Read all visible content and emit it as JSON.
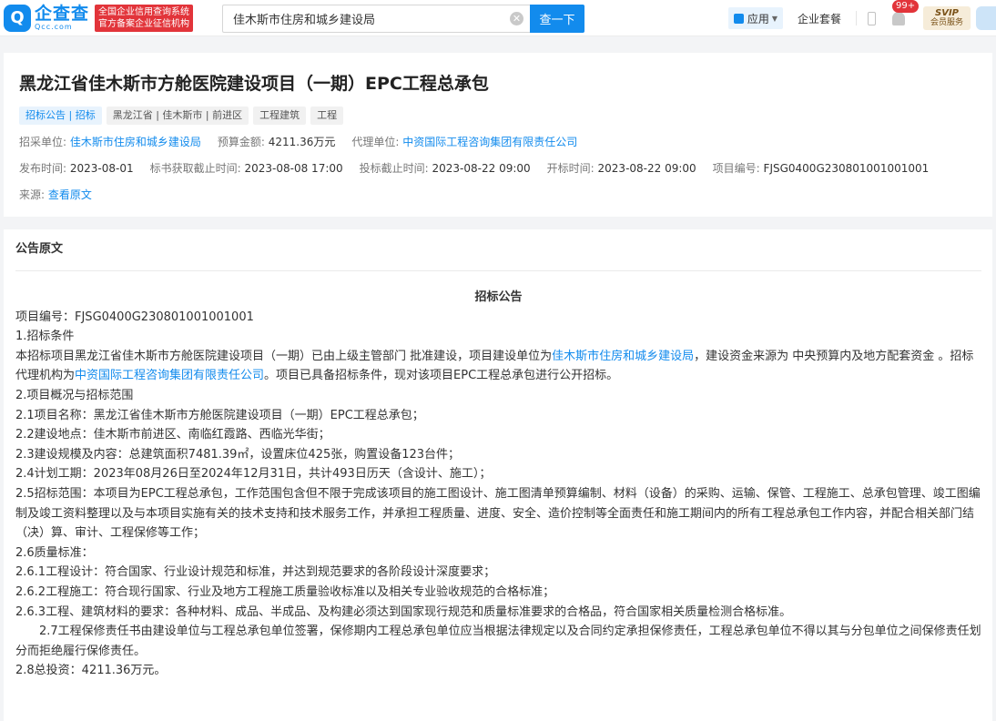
{
  "topbar": {
    "logo_mark": "Q",
    "logo_cn": "企查查",
    "logo_en": "Qcc.com",
    "slogan_line1": "全国企业信用查询系统",
    "slogan_line2": "官方备案企业征信机构",
    "search_value": "佳木斯市住房和城乡建设局",
    "search_button": "查一下",
    "app_label": "应用",
    "enterprise_package": "企业套餐",
    "notification_badge": "99+",
    "svip_top": "SVIP",
    "svip_bottom": "会员服务"
  },
  "header": {
    "title": "黑龙江省佳木斯市方舱医院建设项目（一期）EPC工程总承包",
    "tags": [
      "招标公告 | 招标",
      "黑龙江省 | 佳木斯市 | 前进区",
      "工程建筑",
      "工程"
    ],
    "purchaser_label": "招采单位:",
    "purchaser_value": "佳木斯市住房和城乡建设局",
    "budget_label": "预算金额:",
    "budget_value": "4211.36万元",
    "agent_label": "代理单位:",
    "agent_value": "中资国际工程咨询集团有限责任公司",
    "publish_label": "发布时间:",
    "publish_value": "2023-08-01",
    "doc_deadline_label": "标书获取截止时间:",
    "doc_deadline_value": "2023-08-08 17:00",
    "bid_deadline_label": "投标截止时间:",
    "bid_deadline_value": "2023-08-22 09:00",
    "open_label": "开标时间:",
    "open_value": "2023-08-22 09:00",
    "project_no_label": "项目编号:",
    "project_no_value": "FJSG0400G230801001001001",
    "source_label": "来源:",
    "source_link": "查看原文"
  },
  "notice": {
    "section_title": "公告原文",
    "heading": "招标公告",
    "p_project_no": "项目编号：FJSG0400G230801001001001",
    "p_1": "1.招标条件",
    "p_1a_pre": "本招标项目黑龙江省佳木斯市方舱医院建设项目（一期）已由上级主管部门 批准建设，项目建设单位为",
    "p_1a_link": "佳木斯市住房和城乡建设局",
    "p_1a_post": "，建设资金来源为 中央预算内及地方配套资金 。招标代理机构为",
    "p_1a_link2": "中资国际工程咨询集团有限责任公司",
    "p_1a_end": "。项目已具备招标条件，现对该项目EPC工程总承包进行公开招标。",
    "p_2": "2.项目概况与招标范围",
    "p_2_1": "2.1项目名称：黑龙江省佳木斯市方舱医院建设项目（一期）EPC工程总承包；",
    "p_2_2": "2.2建设地点：佳木斯市前进区、南临红霞路、西临光华街；",
    "p_2_3": "2.3建设规模及内容：总建筑面积7481.39㎡，设置床位425张，购置设备123台件；",
    "p_2_4": "2.4计划工期：2023年08月26日至2024年12月31日，共计493日历天（含设计、施工）；",
    "p_2_5": "2.5招标范围：本项目为EPC工程总承包，工作范围包含但不限于完成该项目的施工图设计、施工图清单预算编制、材料（设备）的采购、运输、保管、工程施工、总承包管理、竣工图编制及竣工资料整理以及与本项目实施有关的技术支持和技术服务工作，并承担工程质量、进度、安全、造价控制等全面责任和施工期间内的所有工程总承包工作内容，并配合相关部门结（决）算、审计、工程保修等工作；",
    "p_2_6": "2.6质量标准：",
    "p_2_6_1": "2.6.1工程设计：符合国家、行业设计规范和标准，并达到规范要求的各阶段设计深度要求；",
    "p_2_6_2": "2.6.2工程施工：符合现行国家、行业及地方工程施工质量验收标准以及相关专业验收规范的合格标准；",
    "p_2_6_3": "2.6.3工程、建筑材料的要求：各种材料、成品、半成品、及构建必须达到国家现行规范和质量标准要求的合格品，符合国家相关质量检测合格标准。",
    "p_2_7": "2.7工程保修责任书由建设单位与工程总承包单位签署，保修期内工程总承包单位应当根据法律规定以及合同约定承担保修责任，工程总承包单位不得以其与分包单位之间保修责任划分而拒绝履行保修责任。",
    "p_2_8": "2.8总投资：4211.36万元。"
  }
}
